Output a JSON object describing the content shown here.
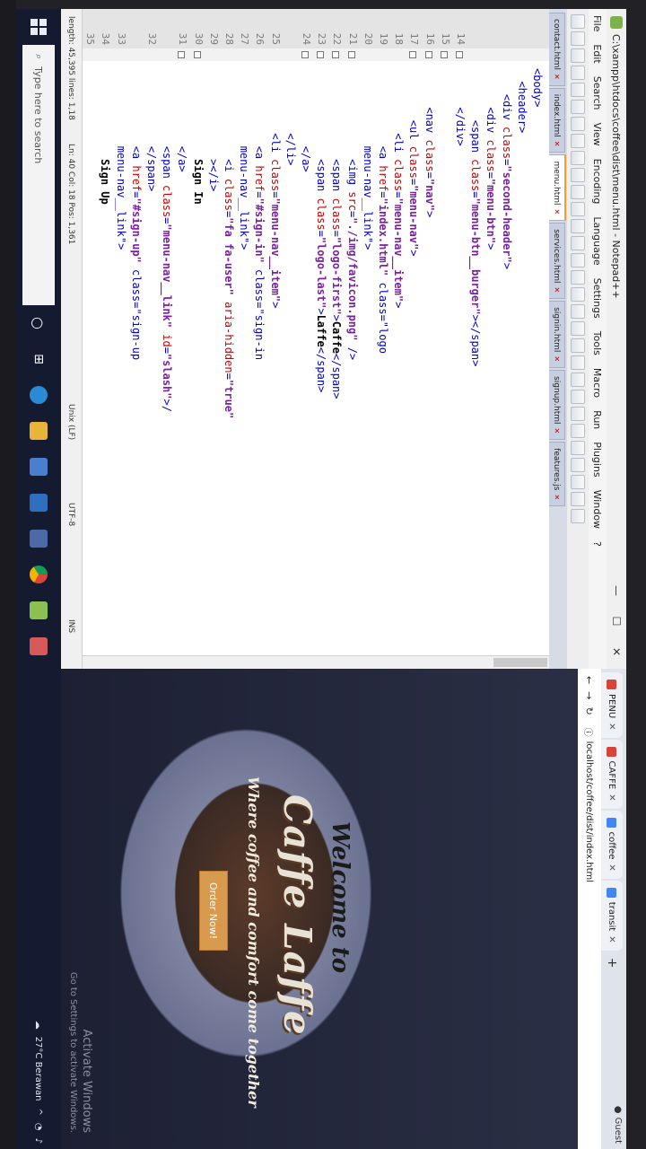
{
  "notepadpp": {
    "title": "C:\\xampp\\htdocs\\coffee\\dist\\menu.html - Notepad++",
    "menu": [
      "File",
      "Edit",
      "Search",
      "View",
      "Encoding",
      "Language",
      "Settings",
      "Tools",
      "Macro",
      "Run",
      "Plugins",
      "Window",
      "?"
    ],
    "tabs": [
      {
        "label": "contact.html",
        "active": false
      },
      {
        "label": "index.html",
        "active": false
      },
      {
        "label": "menu.html",
        "active": true
      },
      {
        "label": "services.html",
        "active": false
      },
      {
        "label": "signin.html",
        "active": false
      },
      {
        "label": "signup.html",
        "active": false
      },
      {
        "label": "features.js",
        "active": false
      }
    ],
    "lines": [
      {
        "n": "14",
        "code": "<body>"
      },
      {
        "n": "15",
        "code": "  <header>"
      },
      {
        "n": "16",
        "code": "    <div class=\"second-header\">"
      },
      {
        "n": "17",
        "code": "      <div class=\"menu-btn\">"
      },
      {
        "n": "18",
        "code": "        <span class=\"menu-btn__burger\"></span>"
      },
      {
        "n": "19",
        "code": "      </div>"
      },
      {
        "n": "20",
        "code": ""
      },
      {
        "n": "21",
        "code": "      <nav class=\"nav\">"
      },
      {
        "n": "22",
        "code": "        <ul class=\"menu-nav\">"
      },
      {
        "n": "23",
        "code": "          <li class=\"menu-nav__item\">"
      },
      {
        "n": "24",
        "code": "            <a href=\"index.html\" class=\"logo"
      },
      {
        "n": "",
        "code": "            menu-nav__link\">"
      },
      {
        "n": "25",
        "code": "              <img src=\"./img/favicon.png\" />"
      },
      {
        "n": "26",
        "code": "              <span class=\"logo-first\">Caffe</span>"
      },
      {
        "n": "27",
        "code": "              <span class=\"logo-last\">Laffe</span>"
      },
      {
        "n": "28",
        "code": "            </a>"
      },
      {
        "n": "29",
        "code": "          </li>"
      },
      {
        "n": "30",
        "code": "          <li class=\"menu-nav__item\">"
      },
      {
        "n": "31",
        "code": "            <a href=\"#sign-in\" class=\"sign-in"
      },
      {
        "n": "",
        "code": "            menu-nav__link\">"
      },
      {
        "n": "32",
        "code": "              <i class=\"fa fa-user\" aria-hidden=\"true\""
      },
      {
        "n": "",
        "code": "              ></i>"
      },
      {
        "n": "33",
        "code": "              Sign In"
      },
      {
        "n": "34",
        "code": "            </a>"
      },
      {
        "n": "35",
        "code": "            <span class=\"menu-nav__link\" id=\"slash\">/"
      },
      {
        "n": "",
        "code": "            </span>"
      },
      {
        "n": "36",
        "code": "            <a href=\"#sign-up\" class=\"sign-up"
      },
      {
        "n": "",
        "code": "            menu-nav__link\">"
      },
      {
        "n": "37",
        "code": "              Sign Up"
      }
    ],
    "status": {
      "length": "length: 45,395   lines: 1,18",
      "pos": "Ln: 40   Col: 18   Pos: 1,361",
      "eol": "Unix (LF)",
      "enc": "UTF-8",
      "ins": "INS"
    }
  },
  "browser": {
    "tabs": [
      {
        "label": "PENU",
        "color": "#d9443a"
      },
      {
        "label": "CAFFE",
        "color": "#d9443a"
      },
      {
        "label": "coffee",
        "color": "#4285f4"
      },
      {
        "label": "transit",
        "color": "#4285f4"
      }
    ],
    "guest": "Guest",
    "url": "localhost/coffee/dist/index.html",
    "hero": {
      "welcome": "Welcome to",
      "brand": "Caffe Laffe",
      "tagline": "Where coffee and comfort come together",
      "button": "Order Now!"
    },
    "activate": {
      "line1": "Activate Windows",
      "line2": "Go to Settings to activate Windows."
    }
  },
  "taskbar": {
    "search_placeholder": "Type here to search",
    "weather": "27°C Berawan"
  }
}
